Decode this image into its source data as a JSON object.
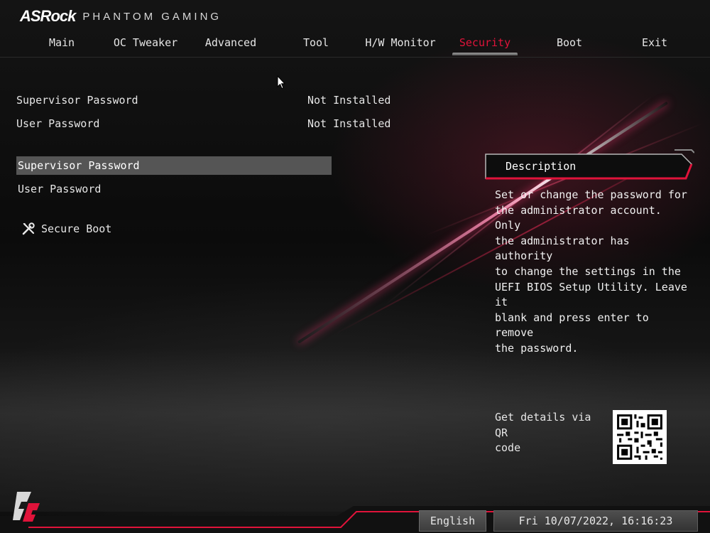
{
  "header": {
    "brand": "ASRock",
    "subtitle": "PHANTOM GAMING"
  },
  "tabs": [
    {
      "label": "Main"
    },
    {
      "label": "OC Tweaker"
    },
    {
      "label": "Advanced"
    },
    {
      "label": "Tool"
    },
    {
      "label": "H/W Monitor"
    },
    {
      "label": "Security"
    },
    {
      "label": "Boot"
    },
    {
      "label": "Exit"
    }
  ],
  "active_tab": "Security",
  "status": {
    "supervisor_label": "Supervisor Password",
    "supervisor_value": "Not Installed",
    "user_label": "User Password",
    "user_value": "Not Installed"
  },
  "menu": {
    "supervisor_password": "Supervisor Password",
    "user_password": "User Password",
    "secure_boot": "Secure Boot"
  },
  "description": {
    "title": "Description",
    "text": "Set or change the password for\nthe administrator account. Only\nthe administrator has authority\nto change the settings in the\nUEFI BIOS Setup Utility. Leave it\nblank and press enter to remove\nthe password."
  },
  "qr": {
    "label": "Get details via QR\ncode"
  },
  "footer": {
    "language": "English",
    "datetime": "Fri 10/07/2022, 16:16:23"
  },
  "colors": {
    "accent": "#e0133a",
    "selection": "#555555",
    "text": "#e6e6e6"
  }
}
